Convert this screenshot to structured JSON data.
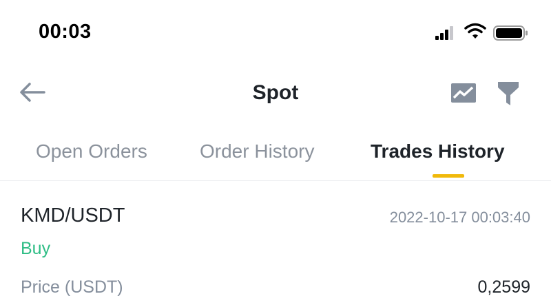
{
  "status_bar": {
    "time": "00:03"
  },
  "header": {
    "title": "Spot",
    "back_icon": "arrow-left-icon",
    "chart_icon": "chart-icon",
    "filter_icon": "filter-icon"
  },
  "tabs": [
    {
      "label": "Open Orders",
      "active": false
    },
    {
      "label": "Order History",
      "active": false
    },
    {
      "label": "Trades History",
      "active": true
    }
  ],
  "trade": {
    "pair": "KMD/USDT",
    "time": "2022-10-17 00:03:40",
    "side": "Buy",
    "price_label": "Price (USDT)",
    "price_value": "0,2599"
  },
  "colors": {
    "accent": "#f0b90b",
    "buy": "#2ebd85",
    "muted_text": "#848e9c",
    "primary_text": "#1e2329"
  }
}
